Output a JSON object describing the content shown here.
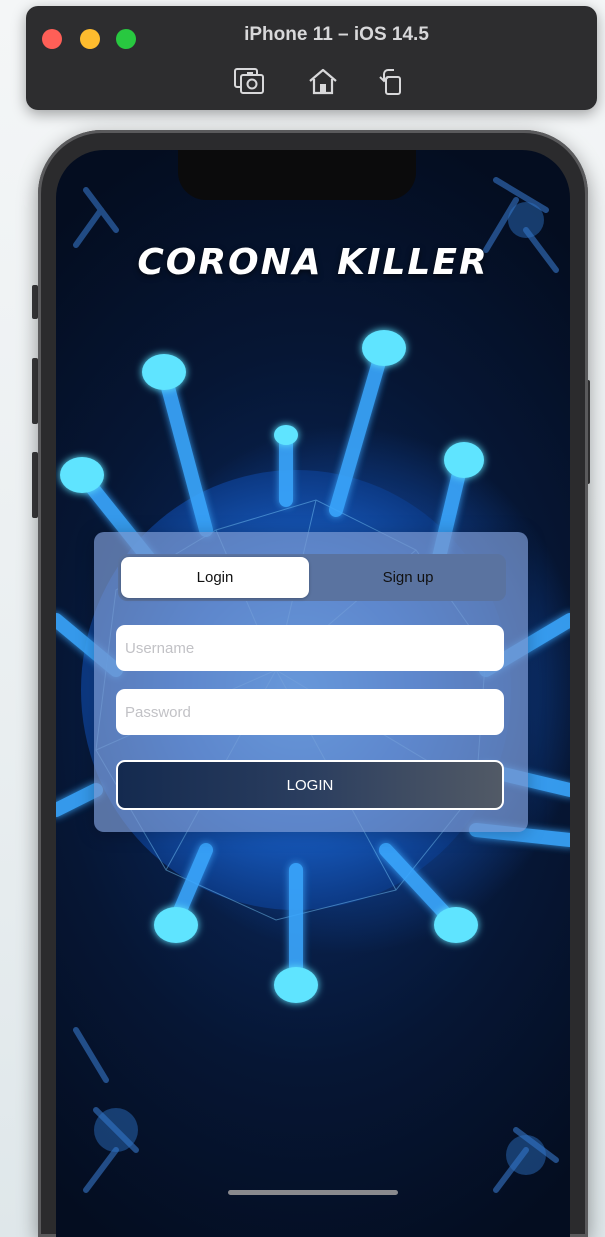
{
  "simulator": {
    "title": "iPhone 11 – iOS 14.5",
    "icons": [
      "screenshot-icon",
      "home-icon",
      "rotate-icon"
    ]
  },
  "app": {
    "title": "CORONA KILLER",
    "tabs": [
      {
        "label": "Login",
        "selected": true
      },
      {
        "label": "Sign up",
        "selected": false
      }
    ],
    "username": {
      "placeholder": "Username",
      "value": ""
    },
    "password": {
      "placeholder": "Password",
      "value": ""
    },
    "login_button": "LOGIN"
  },
  "colors": {
    "window_close": "#fe5f57",
    "window_minimize": "#febc2e",
    "window_zoom": "#28c840",
    "background_dark": "#061634",
    "virus_glow": "#2a8cff"
  }
}
